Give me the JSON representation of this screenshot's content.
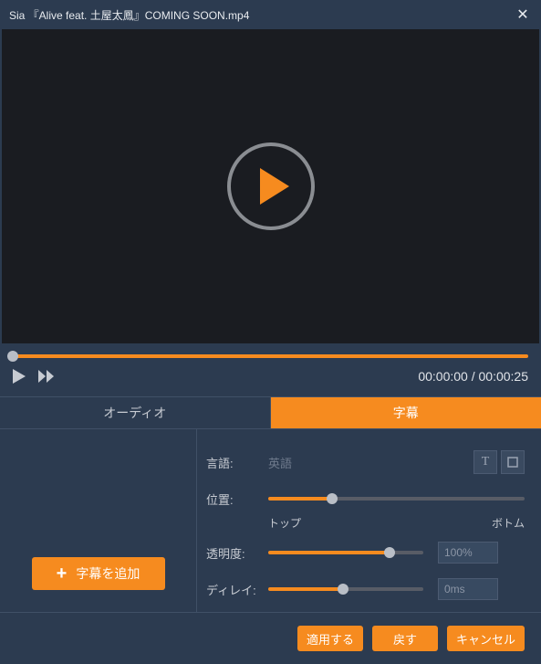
{
  "title": "Sia 『Alive feat. 土屋太鳳』COMING SOON.mp4",
  "time": {
    "current": "00:00:00",
    "sep": " / ",
    "total": "00:00:25"
  },
  "tabs": {
    "audio": "オーディオ",
    "subtitle": "字幕"
  },
  "fields": {
    "language": {
      "label": "言語:",
      "value": "英語"
    },
    "position": {
      "label": "位置:",
      "top": "トップ",
      "bottom": "ボトム",
      "pct": 25
    },
    "opacity": {
      "label": "透明度:",
      "value": "100%",
      "pct": 78
    },
    "delay": {
      "label": "ディレイ:",
      "value": "0ms",
      "pct": 48
    }
  },
  "addSubtitle": "字幕を追加",
  "footer": {
    "apply": "適用する",
    "reset": "戻す",
    "cancel": "キャンセル"
  }
}
